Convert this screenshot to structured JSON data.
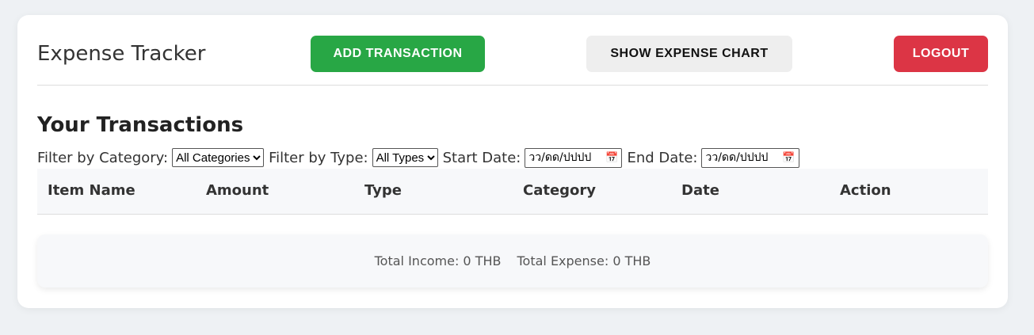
{
  "header": {
    "title": "Expense Tracker",
    "add_label": "ADD TRANSACTION",
    "chart_label": "SHOW EXPENSE CHART",
    "logout_label": "LOGOUT"
  },
  "section_title": "Your Transactions",
  "filters": {
    "category_label": "Filter by Category:",
    "category_value": "All Categories",
    "type_label": "Filter by Type:",
    "type_value": "All Types",
    "start_label": "Start Date:",
    "start_placeholder": "วว/ดด/ปปปป",
    "end_label": "End Date:",
    "end_placeholder": "วว/ดด/ปปปป"
  },
  "table": {
    "columns": [
      "Item Name",
      "Amount",
      "Type",
      "Category",
      "Date",
      "Action"
    ]
  },
  "summary": {
    "income": "Total Income: 0 THB",
    "expense": "Total Expense: 0 THB"
  },
  "colors": {
    "add": "#28a745",
    "logout": "#dc3545",
    "chart": "#eeeeee"
  }
}
